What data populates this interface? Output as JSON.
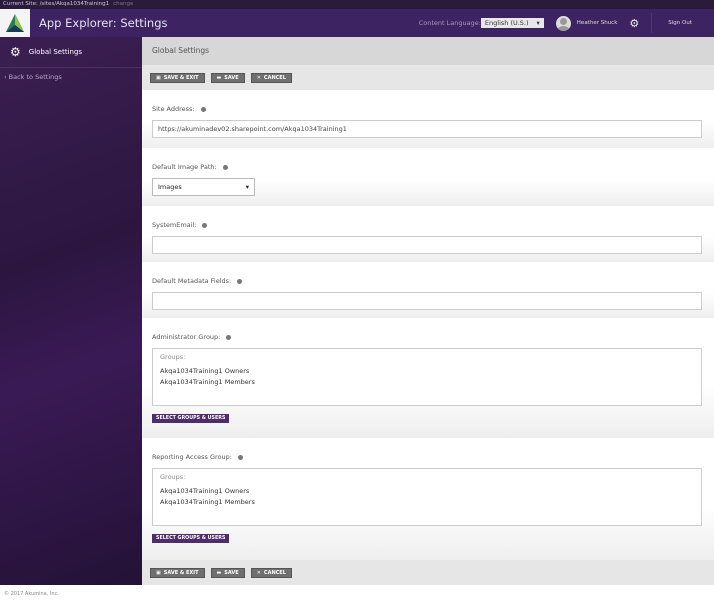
{
  "topbar": {
    "current_site": "Current Site: /sites/Akqa1034Training1",
    "change": "change"
  },
  "header": {
    "app_title": "App Explorer: Settings",
    "content_language_label": "Content Language:",
    "language": "English (U.S.)",
    "user_name": "Heather Shuck",
    "sign_out": "Sign Out"
  },
  "sidebar": {
    "title": "Global Settings",
    "back": "‹ Back to Settings"
  },
  "main": {
    "title": "Global Settings",
    "toolbar": {
      "save_exit": "SAVE & EXIT",
      "save": "SAVE",
      "cancel": "CANCEL"
    },
    "site_address": {
      "label": "Site Address:",
      "value": "https://akuminadev02.sharepoint.com/Akqa1034Training1"
    },
    "image_path": {
      "label": "Default Image Path:",
      "value": "Images"
    },
    "system_email": {
      "label": "SystemEmail:",
      "value": ""
    },
    "metadata": {
      "label": "Default Metadata Fields:",
      "value": ""
    },
    "admin_group": {
      "label": "Administrator Group:",
      "groups_label": "Groups:",
      "groups": [
        "Akqa1034Training1 Owners",
        "Akqa1034Training1 Members"
      ],
      "button": "SELECT GROUPS & USERS"
    },
    "reporting_group": {
      "label": "Reporting Access Group:",
      "groups_label": "Groups:",
      "groups": [
        "Akqa1034Training1 Owners",
        "Akqa1034Training1 Members"
      ],
      "button": "SELECT GROUPS & USERS"
    }
  },
  "footer": {
    "copyright": "© 2017 Akumina, Inc."
  }
}
